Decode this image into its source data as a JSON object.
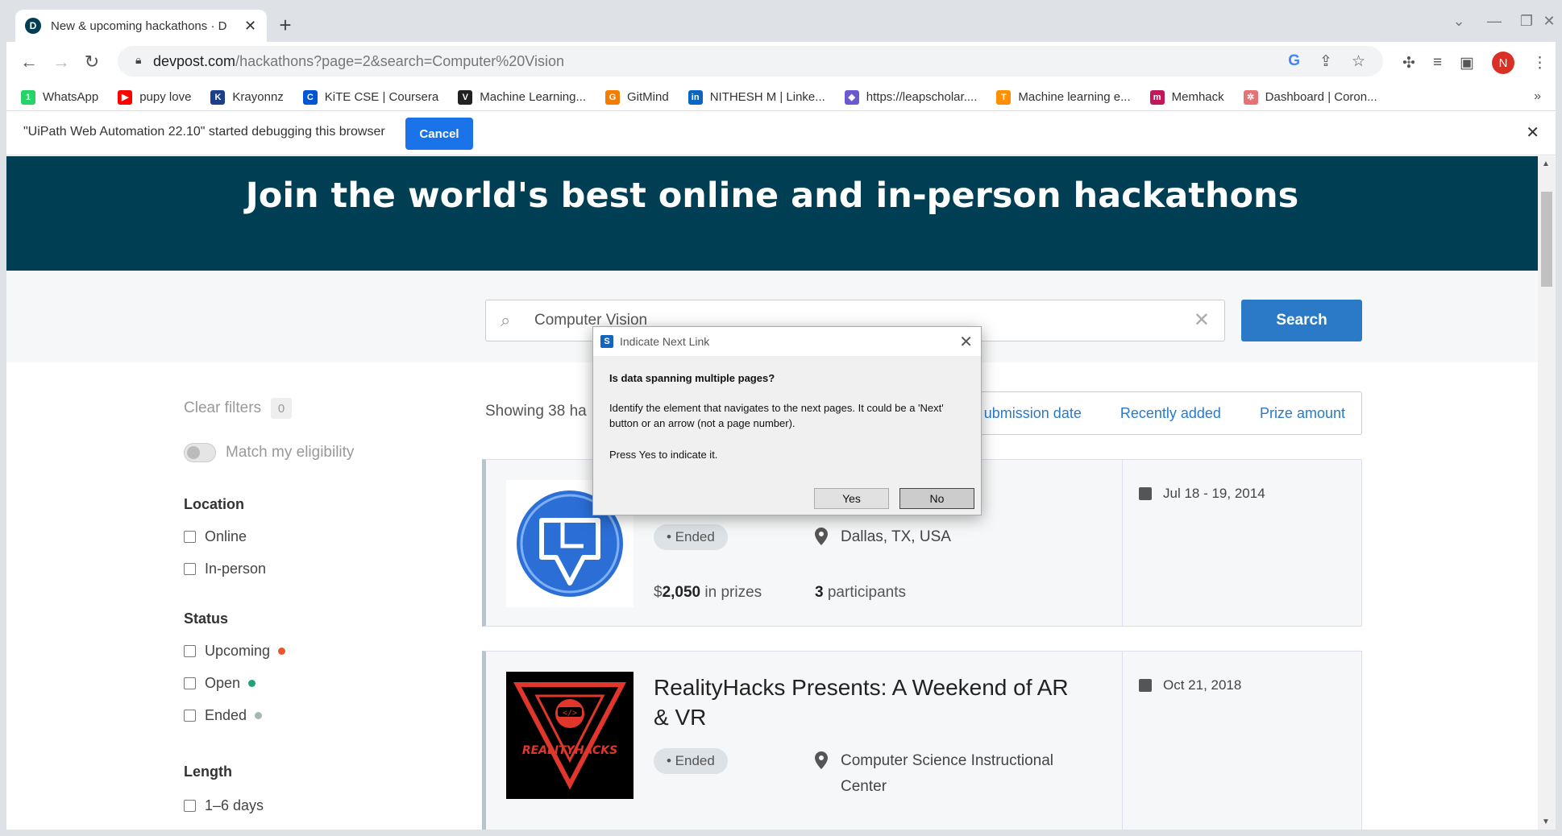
{
  "browser": {
    "tab_title": "New & upcoming hackathons · D",
    "tab_favicon": "D",
    "url_domain": "devpost.com",
    "url_path": "/hackathons?page=2&search=Computer%20Vision",
    "profile_initial": "N"
  },
  "bookmarks": [
    {
      "label": "WhatsApp",
      "color": "#25d366",
      "glyph": "1"
    },
    {
      "label": "pupy love",
      "color": "#ff0000",
      "glyph": "▶"
    },
    {
      "label": "Krayonnz",
      "color": "#1b3f8b",
      "glyph": "K"
    },
    {
      "label": "KiTE CSE | Coursera",
      "color": "#0056d2",
      "glyph": "C"
    },
    {
      "label": "Machine Learning...",
      "color": "#222222",
      "glyph": "V"
    },
    {
      "label": "GitMind",
      "color": "#f57c00",
      "glyph": "G"
    },
    {
      "label": "NITHESH M | Linke...",
      "color": "#0a66c2",
      "glyph": "in"
    },
    {
      "label": "https://leapscholar....",
      "color": "#6a5acd",
      "glyph": "◆"
    },
    {
      "label": "Machine learning e...",
      "color": "#ff8f00",
      "glyph": "T"
    },
    {
      "label": "Memhack",
      "color": "#c2185b",
      "glyph": "m"
    },
    {
      "label": "Dashboard | Coron...",
      "color": "#e57373",
      "glyph": "✲"
    }
  ],
  "infobar": {
    "text": "\"UiPath Web Automation 22.10\" started debugging this browser",
    "cancel": "Cancel"
  },
  "hero": {
    "title": "Join the world's best online and in-person hackathons"
  },
  "search": {
    "value": "Computer Vision",
    "button": "Search"
  },
  "filters": {
    "clear_label": "Clear filters",
    "clear_count": "0",
    "eligibility": "Match my eligibility",
    "location_head": "Location",
    "location": [
      "Online",
      "In-person"
    ],
    "status_head": "Status",
    "status": [
      {
        "label": "Upcoming",
        "color": "#e8572a"
      },
      {
        "label": "Open",
        "color": "#21a179"
      },
      {
        "label": "Ended",
        "color": "#a4b8b0"
      }
    ],
    "length_head": "Length",
    "length": [
      "1–6 days"
    ]
  },
  "results": {
    "showing": "Showing 38 ha",
    "sort": [
      "ubmission date",
      "Recently added",
      "Prize amount"
    ]
  },
  "cards": [
    {
      "status": "• Ended",
      "location": "Dallas, TX, USA",
      "prize_prefix": "$",
      "prize_amount": "2,050",
      "prize_suffix": "in prizes",
      "participants_num": "3",
      "participants_label": "participants",
      "date": "Jul 18 - 19, 2014"
    },
    {
      "title": "RealityHacks Presents: A Weekend of AR & VR",
      "logo_text": "REALITYHACKS",
      "status": "• Ended",
      "location": "Computer Science Instructional Center",
      "date": "Oct 21, 2018"
    }
  ],
  "dialog": {
    "title": "Indicate Next Link",
    "question": "Is data spanning multiple pages?",
    "body": "Identify the element that navigates to the next pages. It could be a 'Next' button or an arrow (not a page number).",
    "prompt": "Press Yes to indicate it.",
    "yes": "Yes",
    "no": "No"
  }
}
